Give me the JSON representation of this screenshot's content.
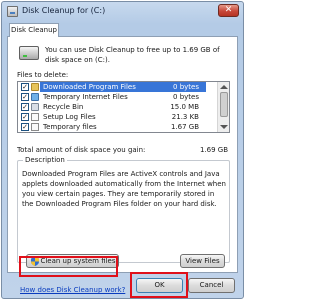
{
  "window": {
    "title": "Disk Cleanup for (C:)",
    "close_label": "✕"
  },
  "tab": {
    "label": "Disk Cleanup"
  },
  "intro_text": "You can use Disk Cleanup to free up to 1.69 GB of disk space on (C:).",
  "files_label": "Files to delete:",
  "files": [
    {
      "name": "Downloaded Program Files",
      "size": "0 bytes",
      "checked": true,
      "icon": "folder-icon"
    },
    {
      "name": "Temporary Internet Files",
      "size": "0 bytes",
      "checked": true,
      "icon": "web-icon"
    },
    {
      "name": "Recycle Bin",
      "size": "15.0 MB",
      "checked": true,
      "icon": "recycle-bin-icon"
    },
    {
      "name": "Setup Log Files",
      "size": "21.3 KB",
      "checked": true,
      "icon": "document-icon"
    },
    {
      "name": "Temporary files",
      "size": "1.67 GB",
      "checked": true,
      "icon": "document-icon"
    }
  ],
  "total_label": "Total amount of disk space you gain:",
  "total_value": "1.69 GB",
  "description": {
    "legend": "Description",
    "text": "Downloaded Program Files are ActiveX controls and Java applets downloaded automatically from the Internet when you view certain pages. They are temporarily stored in the Downloaded Program Files folder on your hard disk."
  },
  "buttons": {
    "cleanup_system": "Clean up system files",
    "view_files": "View Files",
    "ok": "OK",
    "cancel": "Cancel"
  },
  "help_link": "How does Disk Cleanup work?",
  "colors": {
    "selection": "#3875d7",
    "highlight": "#e0101a",
    "link": "#0a3cbe"
  }
}
